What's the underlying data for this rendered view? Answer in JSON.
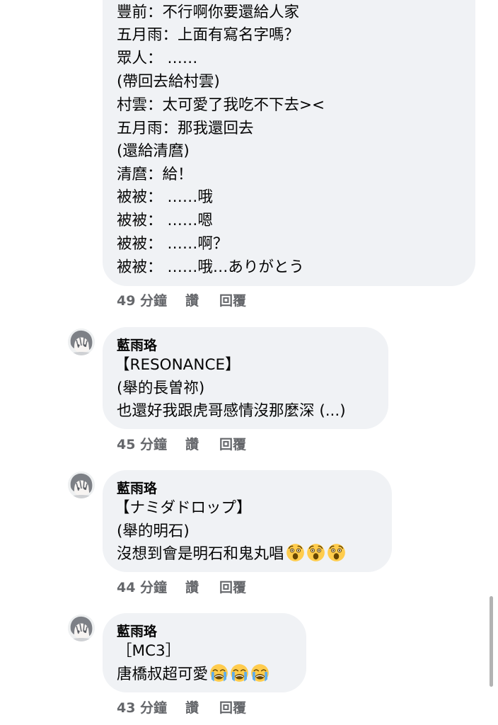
{
  "first_comment": {
    "lines": [
      "豐前：不行啊你要還給人家",
      "五月雨：上面有寫名字嗎？",
      "眾人：  ……",
      "(帶回去給村雲)",
      "村雲：太可愛了我吃不下去><",
      "五月雨：那我還回去",
      "(還給清麿)",
      "清麿：給！",
      "被被：  ……哦",
      "被被：  ……嗯",
      "被被：  ……啊？",
      "被被：  ……哦…ありがとう"
    ],
    "time": "49 分鐘",
    "like_label": "讚",
    "reply_label": "回覆"
  },
  "comments": [
    {
      "author": "藍雨珞",
      "lines": [
        "【RESONANCE】",
        "(舉的長曽祢)",
        "也還好我跟虎哥感情沒那麼深 (...)"
      ],
      "emojis": [],
      "time": "45 分鐘",
      "like_label": "讚",
      "reply_label": "回覆"
    },
    {
      "author": "藍雨珞",
      "lines": [
        "【ナミダドロップ】",
        "(舉的明石)",
        "沒想到會是明石和鬼丸唱"
      ],
      "emojis": [
        "astonished-face",
        "astonished-face",
        "astonished-face"
      ],
      "time": "44 分鐘",
      "like_label": "讚",
      "reply_label": "回覆"
    },
    {
      "author": "藍雨珞",
      "lines": [
        "［MC3］",
        "唐橋叔超可愛"
      ],
      "emojis": [
        "loudly-crying-face",
        "loudly-crying-face",
        "loudly-crying-face"
      ],
      "time": "43 分鐘",
      "like_label": "讚",
      "reply_label": "回覆"
    }
  ],
  "colors": {
    "bubble": "#f0f2f5",
    "text": "#050505",
    "meta": "#65676b",
    "emoji_yellow": "#ffcc4d",
    "emoji_tear": "#5dadec"
  }
}
